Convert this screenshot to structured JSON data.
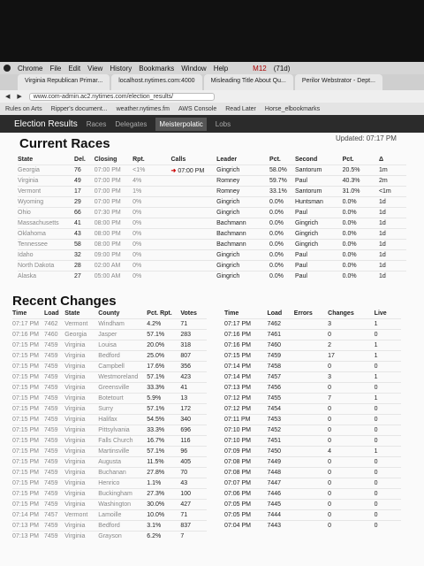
{
  "menubar": {
    "items": [
      "Chrome",
      "File",
      "Edit",
      "View",
      "History",
      "Bookmarks",
      "Window",
      "Help"
    ],
    "battery": "(71d)",
    "mail": "M12"
  },
  "tabs": [
    "Virginia Republican Primar...",
    "localhost.nytimes.com:4000",
    "Misleading Title About Qu...",
    "Perilor Webstrator - Dept..."
  ],
  "address": {
    "url": "www.com-admin.ac2.nytimes.com/election_results/",
    "back": "Bookmark"
  },
  "bookmarks": [
    "Rules on Arts",
    "Ripper's document...",
    "weather.nytimes.fm",
    "AWS Console",
    "Read Later",
    "Horse_elbookmarks"
  ],
  "nav": {
    "brand": "Election Results",
    "items": [
      "Races",
      "Delegates",
      "Meisterpolatic",
      "Lobs"
    ]
  },
  "current": {
    "title": "Current Races",
    "updated": "Updated: 07:17 PM",
    "headers": [
      "State",
      "Del.",
      "Closing",
      "Rpt.",
      "Calls",
      "Leader",
      "Pct.",
      "Second",
      "Pct.",
      "Δ"
    ],
    "rows": [
      [
        "Georgia",
        "76",
        "07:00 PM",
        "<1%",
        "07:00 PM",
        "Gingrich",
        "58.0%",
        "Santorum",
        "20.5%",
        "1m"
      ],
      [
        "Virginia",
        "49",
        "07:00 PM",
        "4%",
        "",
        "Romney",
        "59.7%",
        "Paul",
        "40.3%",
        "2m"
      ],
      [
        "Vermont",
        "17",
        "07:00 PM",
        "1%",
        "",
        "Romney",
        "33.1%",
        "Santorum",
        "31.0%",
        "<1m"
      ],
      [
        "Wyoming",
        "29",
        "07:00 PM",
        "0%",
        "",
        "Gingrich",
        "0.0%",
        "Huntsman",
        "0.0%",
        "1d"
      ],
      [
        "Ohio",
        "66",
        "07:30 PM",
        "0%",
        "",
        "Gingrich",
        "0.0%",
        "Paul",
        "0.0%",
        "1d"
      ],
      [
        "Massachusetts",
        "41",
        "08:00 PM",
        "0%",
        "",
        "Bachmann",
        "0.0%",
        "Gingrich",
        "0.0%",
        "1d"
      ],
      [
        "Oklahoma",
        "43",
        "08:00 PM",
        "0%",
        "",
        "Bachmann",
        "0.0%",
        "Gingrich",
        "0.0%",
        "1d"
      ],
      [
        "Tennessee",
        "58",
        "08:00 PM",
        "0%",
        "",
        "Bachmann",
        "0.0%",
        "Gingrich",
        "0.0%",
        "1d"
      ],
      [
        "Idaho",
        "32",
        "09:00 PM",
        "0%",
        "",
        "Gingrich",
        "0.0%",
        "Paul",
        "0.0%",
        "1d"
      ],
      [
        "North Dakota",
        "28",
        "02:00 AM",
        "0%",
        "",
        "Gingrich",
        "0.0%",
        "Paul",
        "0.0%",
        "1d"
      ],
      [
        "Alaska",
        "27",
        "05:00 AM",
        "0%",
        "",
        "Gingrich",
        "0.0%",
        "Paul",
        "0.0%",
        "1d"
      ]
    ]
  },
  "recent": {
    "title": "Recent Changes",
    "headers": [
      "Time",
      "Load",
      "State",
      "County",
      "Pct. Rpt.",
      "Votes"
    ],
    "rows": [
      [
        "07:17 PM",
        "7462",
        "Vermont",
        "Windham",
        "4.2%",
        "71"
      ],
      [
        "07:16 PM",
        "7460",
        "Georgia",
        "Jasper",
        "57.1%",
        "283"
      ],
      [
        "07:15 PM",
        "7459",
        "Virginia",
        "Louisa",
        "20.0%",
        "318"
      ],
      [
        "07:15 PM",
        "7459",
        "Virginia",
        "Bedford",
        "25.0%",
        "807"
      ],
      [
        "07:15 PM",
        "7459",
        "Virginia",
        "Campbell",
        "17.6%",
        "356"
      ],
      [
        "07:15 PM",
        "7459",
        "Virginia",
        "Westmoreland",
        "57.1%",
        "423"
      ],
      [
        "07:15 PM",
        "7459",
        "Virginia",
        "Greensville",
        "33.3%",
        "41"
      ],
      [
        "07:15 PM",
        "7459",
        "Virginia",
        "Botetourt",
        "5.9%",
        "13"
      ],
      [
        "07:15 PM",
        "7459",
        "Virginia",
        "Surry",
        "57.1%",
        "172"
      ],
      [
        "07:15 PM",
        "7459",
        "Virginia",
        "Halifax",
        "54.5%",
        "340"
      ],
      [
        "07:15 PM",
        "7459",
        "Virginia",
        "Pittsylvania",
        "33.3%",
        "696"
      ],
      [
        "07:15 PM",
        "7459",
        "Virginia",
        "Falls Church",
        "16.7%",
        "116"
      ],
      [
        "07:15 PM",
        "7459",
        "Virginia",
        "Martinsville",
        "57.1%",
        "96"
      ],
      [
        "07:15 PM",
        "7459",
        "Virginia",
        "Augusta",
        "11.5%",
        "405"
      ],
      [
        "07:15 PM",
        "7459",
        "Virginia",
        "Buchanan",
        "27.8%",
        "70"
      ],
      [
        "07:15 PM",
        "7459",
        "Virginia",
        "Henrico",
        "1.1%",
        "43"
      ],
      [
        "07:15 PM",
        "7459",
        "Virginia",
        "Buckingham",
        "27.3%",
        "100"
      ],
      [
        "07:15 PM",
        "7459",
        "Virginia",
        "Washington",
        "30.0%",
        "427"
      ],
      [
        "07:14 PM",
        "7457",
        "Vermont",
        "Lamoille",
        "10.0%",
        "71"
      ],
      [
        "07:13 PM",
        "7459",
        "Virginia",
        "Bedford",
        "3.1%",
        "837"
      ],
      [
        "07:13 PM",
        "7459",
        "Virginia",
        "Grayson",
        "6.2%",
        "7"
      ]
    ]
  },
  "loads": {
    "headers": [
      "Time",
      "Load",
      "Errors",
      "Changes",
      "Live"
    ],
    "rows": [
      [
        "07:17 PM",
        "7462",
        "",
        "3",
        "1"
      ],
      [
        "07:16 PM",
        "7461",
        "",
        "0",
        "0"
      ],
      [
        "07:16 PM",
        "7460",
        "",
        "2",
        "1"
      ],
      [
        "07:15 PM",
        "7459",
        "",
        "17",
        "1"
      ],
      [
        "07:14 PM",
        "7458",
        "",
        "0",
        "0"
      ],
      [
        "07:14 PM",
        "7457",
        "",
        "3",
        "1"
      ],
      [
        "07:13 PM",
        "7456",
        "",
        "0",
        "0"
      ],
      [
        "07:12 PM",
        "7455",
        "",
        "7",
        "1"
      ],
      [
        "07:12 PM",
        "7454",
        "",
        "0",
        "0"
      ],
      [
        "07:11 PM",
        "7453",
        "",
        "0",
        "0"
      ],
      [
        "07:10 PM",
        "7452",
        "",
        "0",
        "0"
      ],
      [
        "07:10 PM",
        "7451",
        "",
        "0",
        "0"
      ],
      [
        "07:09 PM",
        "7450",
        "",
        "4",
        "1"
      ],
      [
        "07:08 PM",
        "7449",
        "",
        "0",
        "0"
      ],
      [
        "07:08 PM",
        "7448",
        "",
        "0",
        "0"
      ],
      [
        "07:07 PM",
        "7447",
        "",
        "0",
        "0"
      ],
      [
        "07:06 PM",
        "7446",
        "",
        "0",
        "0"
      ],
      [
        "07:05 PM",
        "7445",
        "",
        "0",
        "0"
      ],
      [
        "07:05 PM",
        "7444",
        "",
        "0",
        "0"
      ],
      [
        "07:04 PM",
        "7443",
        "",
        "0",
        "0"
      ]
    ]
  }
}
